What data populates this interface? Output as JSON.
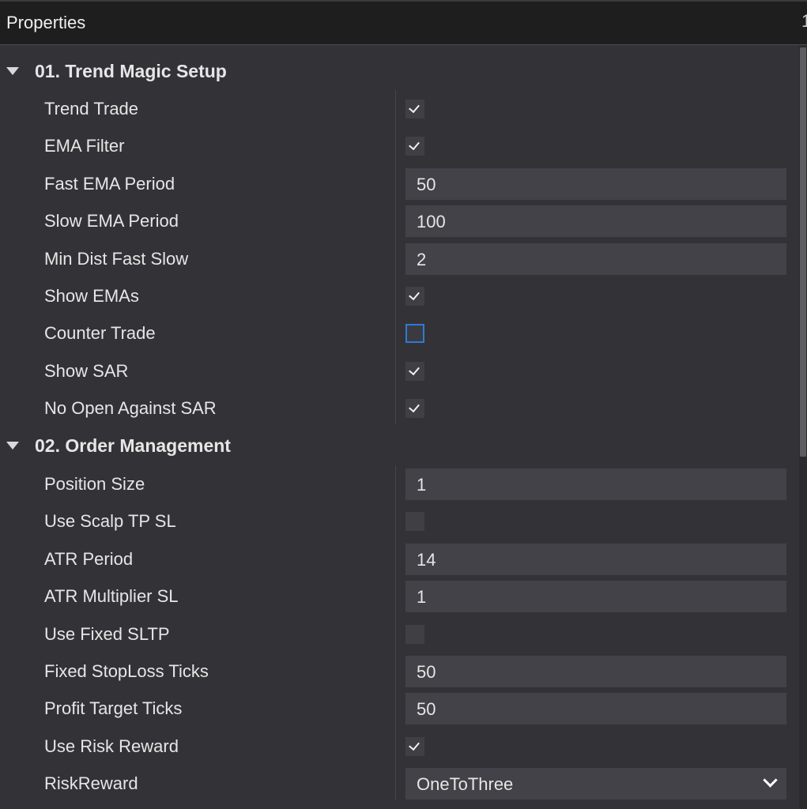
{
  "window": {
    "title": "Properties",
    "edge_glyph": "1"
  },
  "groups": [
    {
      "title": "01. Trend Magic Setup",
      "rows": [
        {
          "label": "Trend Trade",
          "type": "checkbox",
          "checked": true
        },
        {
          "label": "EMA Filter",
          "type": "checkbox",
          "checked": true
        },
        {
          "label": "Fast EMA Period",
          "type": "number",
          "value": "50"
        },
        {
          "label": "Slow EMA Period",
          "type": "number",
          "value": "100"
        },
        {
          "label": "Min Dist Fast Slow",
          "type": "number",
          "value": "2"
        },
        {
          "label": "Show EMAs",
          "type": "checkbox",
          "checked": true
        },
        {
          "label": "Counter Trade",
          "type": "checkbox",
          "checked": false,
          "focused": true
        },
        {
          "label": "Show SAR",
          "type": "checkbox",
          "checked": true
        },
        {
          "label": "No Open Against SAR",
          "type": "checkbox",
          "checked": true
        }
      ]
    },
    {
      "title": "02. Order Management",
      "rows": [
        {
          "label": "Position Size",
          "type": "number",
          "value": "1"
        },
        {
          "label": "Use Scalp TP SL",
          "type": "checkbox",
          "checked": false
        },
        {
          "label": "ATR Period",
          "type": "number",
          "value": "14"
        },
        {
          "label": "ATR Multiplier SL",
          "type": "number",
          "value": "1"
        },
        {
          "label": "Use Fixed SLTP",
          "type": "checkbox",
          "checked": false
        },
        {
          "label": "Fixed StopLoss Ticks",
          "type": "number",
          "value": "50"
        },
        {
          "label": "Profit Target Ticks",
          "type": "number",
          "value": "50"
        },
        {
          "label": "Use Risk Reward",
          "type": "checkbox",
          "checked": true
        },
        {
          "label": "RiskReward",
          "type": "select",
          "value": "OneToThree"
        }
      ]
    }
  ],
  "icons": {
    "group_toggle": "triangle-down-icon",
    "checkbox_mark": "checkmark-icon",
    "dropdown": "chevron-down-icon"
  },
  "colors": {
    "background": "#333337",
    "titlebar": "#1e1e1f",
    "field": "#424248",
    "focus_border": "#2f7ad6",
    "text": "#e6e6e6"
  }
}
